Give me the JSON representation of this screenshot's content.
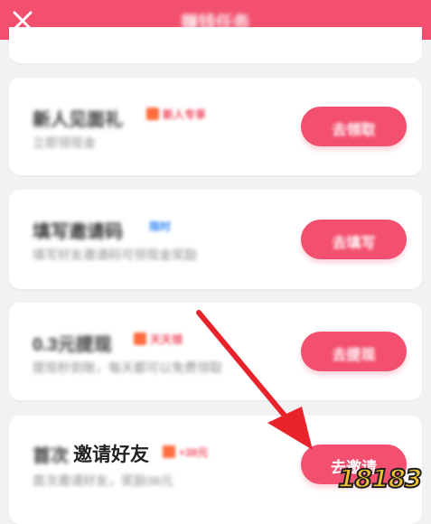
{
  "header": {
    "title": "赚钱任务",
    "close_icon": "close-icon",
    "color": "#f2506e"
  },
  "tasks": [
    {
      "title": "新人见面礼",
      "tag": "新人专享",
      "tag_color": "red",
      "subtitle": "立即领现金",
      "button": "去领取"
    },
    {
      "title": "填写邀请码",
      "tag": "限时",
      "tag_color": "blue",
      "subtitle": "填写好友邀请码可领现金奖励",
      "button": "去填写"
    },
    {
      "title": "0.3元提现",
      "tag": "天天领",
      "tag_color": "red",
      "subtitle": "提现秒到账，每天都可以免费领取",
      "button": "去提现"
    },
    {
      "title": "邀请好友",
      "title_prefix": "首次",
      "tag": "+38元",
      "tag_color": "red",
      "subtitle": "首次邀请好友，奖励38元",
      "button": "去邀请"
    }
  ],
  "annotation": {
    "arrow_color": "#e8232b"
  },
  "watermark": {
    "text": "18183"
  }
}
